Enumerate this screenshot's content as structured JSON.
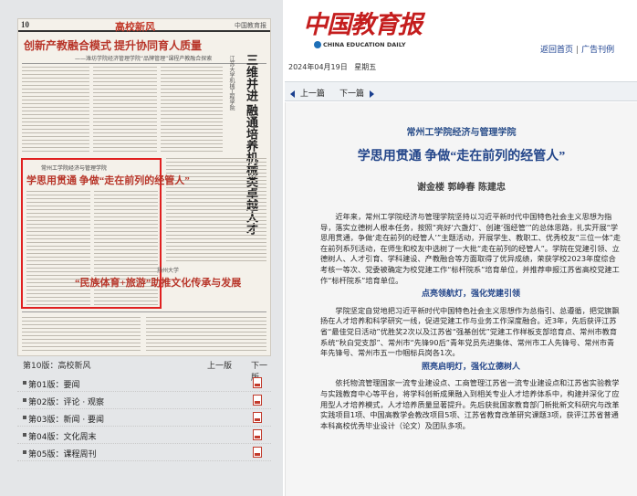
{
  "paper_page": {
    "page_no": "10",
    "section": "高校新风",
    "masthead": "中国教育报",
    "headline_top": "创新产教融合模式  提升协同育人质量",
    "subhead_top": "——潍坊学院经济管理学院“品牌管理”课程产教融合探索",
    "vertical_title": "三维并进 融通培养机械类卓越人才",
    "vertical_small": "江苏大学机械工程学院",
    "highlight_school": "常州工学院经济与管理学院",
    "highlight_title": "学思用贯通  争做“走在前列的经管人”",
    "bottom_small": "扬州大学",
    "headline_bottom": "“民族体育+旅游”助推文化传承与发展"
  },
  "pager": {
    "current": "第10版：高校新风",
    "prev": "上一版",
    "next": "下一版"
  },
  "page_list": [
    {
      "label": "第01版：要闻"
    },
    {
      "label": "第02版：评论 · 观察"
    },
    {
      "label": "第03版：新闻 · 要闻"
    },
    {
      "label": "第04版：文化周末"
    },
    {
      "label": "第05版：课程周刊"
    }
  ],
  "header": {
    "logo_cn": "中国教育报",
    "logo_en": "CHINA EDUCATION DAILY",
    "link_home": "返回首页",
    "link_sep": "|",
    "link_ads": "广告刊例",
    "date": "2024年04月19日",
    "weekday": "星期五"
  },
  "nav": {
    "prev": "上一篇",
    "next": "下一篇"
  },
  "article": {
    "school": "常州工学院经济与管理学院",
    "title": "学思用贯通  争做“走在前列的经管人”",
    "authors": "谢金楼  郭峥春  陈建忠",
    "p1": "近年来，常州工学院经济与管理学院坚持以习近平新时代中国特色社会主义思想为指导，落实立德树人根本任务，按照“亮好‘六盏灯’、创建‘强经管’”的总体思路，扎实开展“学思用贯通，争做‘走在前列的经管人’”主题活动，开展学生、教职工、优秀校友“三位一体”走在前列系列活动，在师生和校友中选树了一大批“走在前列的经管人”。学院在党建引领、立德树人、人才引育、学科建设、产教融合等方面取得了优异成绩，荣获学校2023年度综合考核一等次、党委被确定为校党建工作“标杆院系”培育单位，并推荐申报江苏省高校党建工作“标杆院系”培育单位。",
    "h1": "点亮领航灯，强化党建引领",
    "p2": "学院坚定自觉地把习近平新时代中国特色社会主义思想作为总指引、总遵循，把党旗飘扬在人才培养和科学研究一线，促进党建工作与业务工作深度融合。近3年，先后获评江苏省“最佳党日活动”优胜奖2次以及江苏省“强基创优”党建工作样板支部培育点、常州市教育系统“秋白党支部”、常州市“先锋90后”青年党员先进集体、常州市工人先锋号、常州市青年先锋号、常州市五一巾帼标兵岗各1次。",
    "h2": "照亮启明灯，强化立德树人",
    "p3": "依托物流管理国家一流专业建设点、工商管理江苏省一流专业建设点和江苏省实验教学与实践教育中心等平台，将学科创新成果融入到相关专业人才培养体系中，构建并深化了应用型人才培养模式，人才培养质量显著提升。先后获批国家教育部门新批新文科研究与改革实践项目1项、中国高教学会教改项目5项、江苏省教育改革研究课题3项，获评江苏省普通本科高校优秀毕业设计（论文）及团队多项。"
  },
  "colors": {
    "logo_red": "#c41d1d",
    "title_blue": "#24468a",
    "link_blue": "#1a3f8f",
    "highlight_border": "#e02020"
  },
  "icons": [
    "arrow-left-icon",
    "arrow-right-icon",
    "pdf-icon",
    "globe-icon"
  ]
}
